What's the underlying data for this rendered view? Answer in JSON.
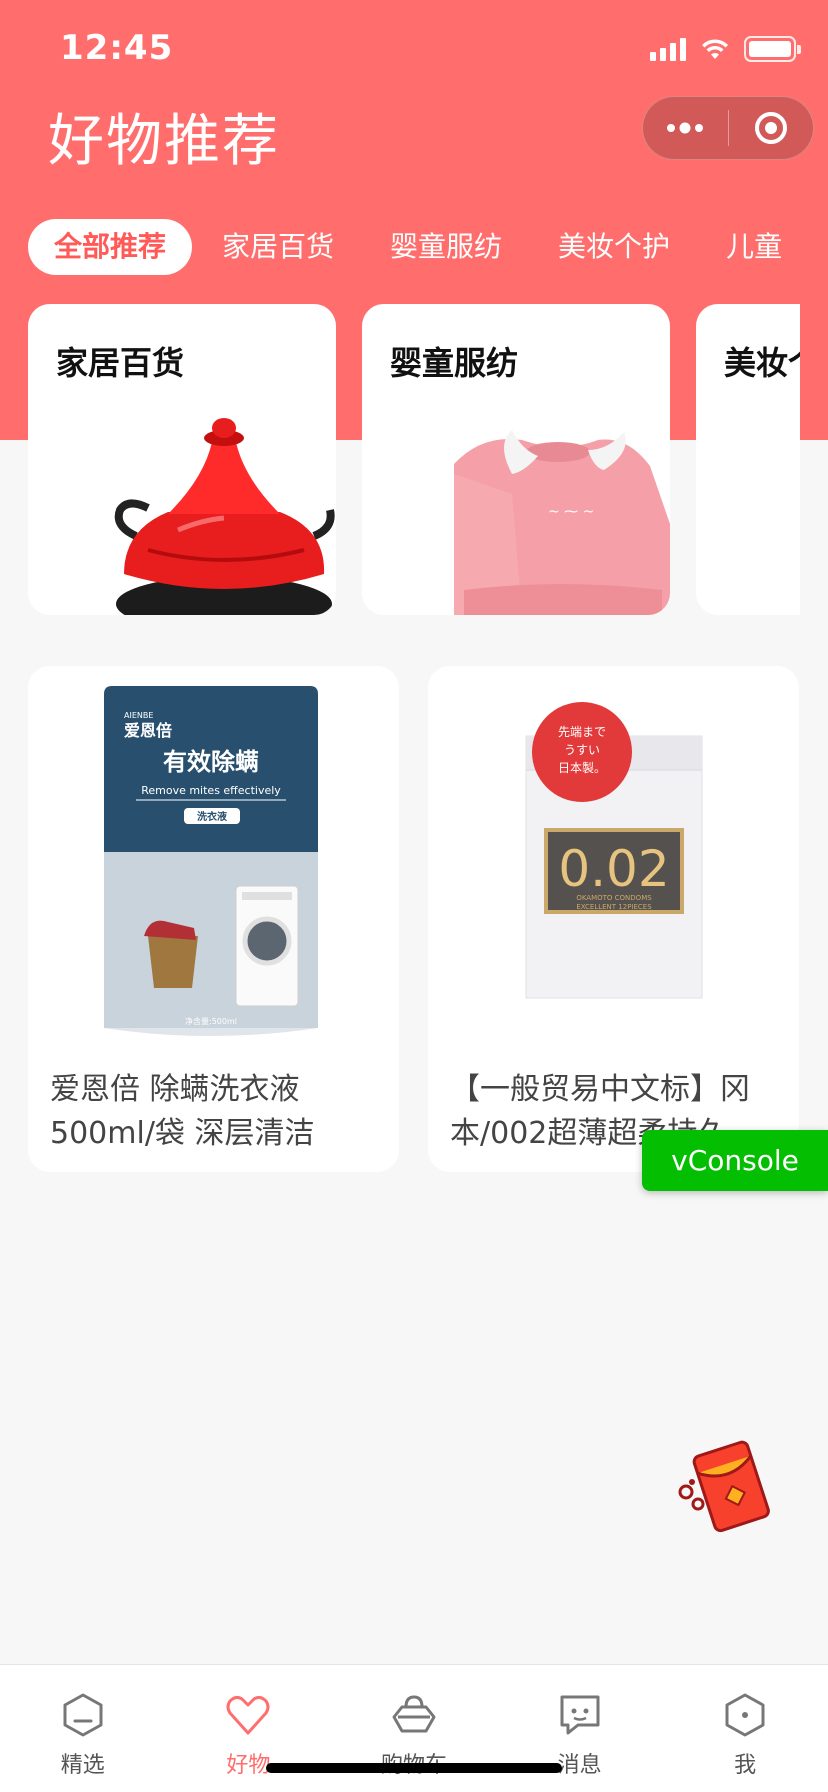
{
  "status_bar": {
    "time": "12:45"
  },
  "header": {
    "title": "好物推荐"
  },
  "tabs": [
    {
      "label": "全部推荐",
      "active": true
    },
    {
      "label": "家居百货"
    },
    {
      "label": "婴童服纺"
    },
    {
      "label": "美妆个护"
    },
    {
      "label": "儿童"
    }
  ],
  "category_cards": [
    {
      "title": "家居百货"
    },
    {
      "title": "婴童服纺"
    },
    {
      "title": "美妆个"
    }
  ],
  "products": [
    {
      "name": "爱恩倍 除螨洗衣液 500ml/袋 深层清洁",
      "image": {
        "brand_en": "AIENBE",
        "brand": "爱恩倍",
        "headline": "有效除螨",
        "tagline": "Remove mites effectively",
        "badge": "洗衣液",
        "net": "净含量:500ml"
      }
    },
    {
      "name": "【一般贸易中文标】冈本/002超薄超柔持久",
      "image": {
        "stamp_line1": "先端まで",
        "stamp_line2": "うすい",
        "stamp_line3": "日本製。",
        "value": "0.02",
        "caption1": "OKAMOTO CONDOMS",
        "caption2": "EXCELLENT 12PIECES"
      }
    }
  ],
  "vconsole": {
    "label": "vConsole"
  },
  "tabbar": [
    {
      "label": "精选",
      "icon": "hexagon-face-icon"
    },
    {
      "label": "好物",
      "icon": "heart-icon",
      "active": true
    },
    {
      "label": "购物车",
      "icon": "bag-icon"
    },
    {
      "label": "消息",
      "icon": "chat-icon"
    },
    {
      "label": "我",
      "icon": "hexagon-dot-icon"
    }
  ],
  "colors": {
    "brand": "#ff6e6c",
    "active_tab_text": "#ff5a57",
    "vconsole": "#04be02"
  }
}
